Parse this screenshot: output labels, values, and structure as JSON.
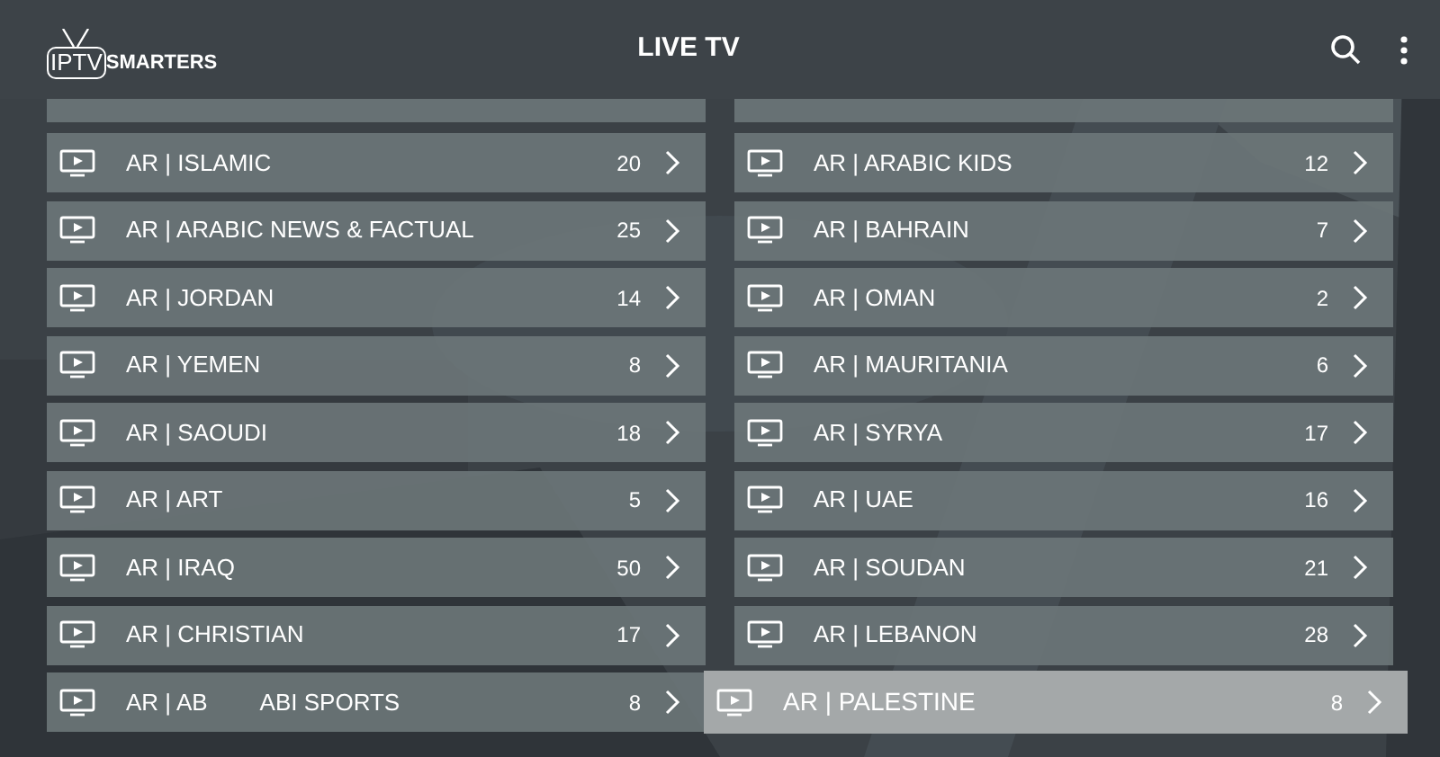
{
  "header": {
    "logo": {
      "left": "IPTV",
      "right": "SMARTERS"
    },
    "title": "LIVE TV"
  },
  "rows": [
    {
      "left": {
        "name": "AR | ISLAMIC",
        "count": "20",
        "selected": false
      },
      "right": {
        "name": "AR | ARABIC KIDS",
        "count": "12",
        "selected": false
      }
    },
    {
      "left": {
        "name": "AR | ARABIC NEWS & FACTUAL",
        "count": "25",
        "selected": false
      },
      "right": {
        "name": "AR | BAHRAIN",
        "count": "7",
        "selected": false
      }
    },
    {
      "left": {
        "name": "AR | JORDAN",
        "count": "14",
        "selected": false
      },
      "right": {
        "name": "AR | OMAN",
        "count": "2",
        "selected": false
      }
    },
    {
      "left": {
        "name": "AR | YEMEN",
        "count": "8",
        "selected": false
      },
      "right": {
        "name": "AR | MAURITANIA",
        "count": "6",
        "selected": false
      }
    },
    {
      "left": {
        "name": "AR | SAOUDI",
        "count": "18",
        "selected": false
      },
      "right": {
        "name": "AR | SYRYA",
        "count": "17",
        "selected": false
      }
    },
    {
      "left": {
        "name": "AR | ART",
        "count": "5",
        "selected": false
      },
      "right": {
        "name": "AR | UAE",
        "count": "16",
        "selected": false
      }
    },
    {
      "left": {
        "name": "AR | IRAQ",
        "count": "50",
        "selected": false
      },
      "right": {
        "name": "AR | SOUDAN",
        "count": "21",
        "selected": false
      }
    },
    {
      "left": {
        "name": "AR | CHRISTIAN",
        "count": "17",
        "selected": false
      },
      "right": {
        "name": "AR | LEBANON",
        "count": "28",
        "selected": false
      }
    },
    {
      "left": {
        "name": "AR | AB",
        "name_rest": "ABI SPORTS",
        "count": "8",
        "selected": false
      },
      "right": {
        "name": "AR | PALESTINE",
        "count": "8",
        "selected": true
      }
    }
  ]
}
